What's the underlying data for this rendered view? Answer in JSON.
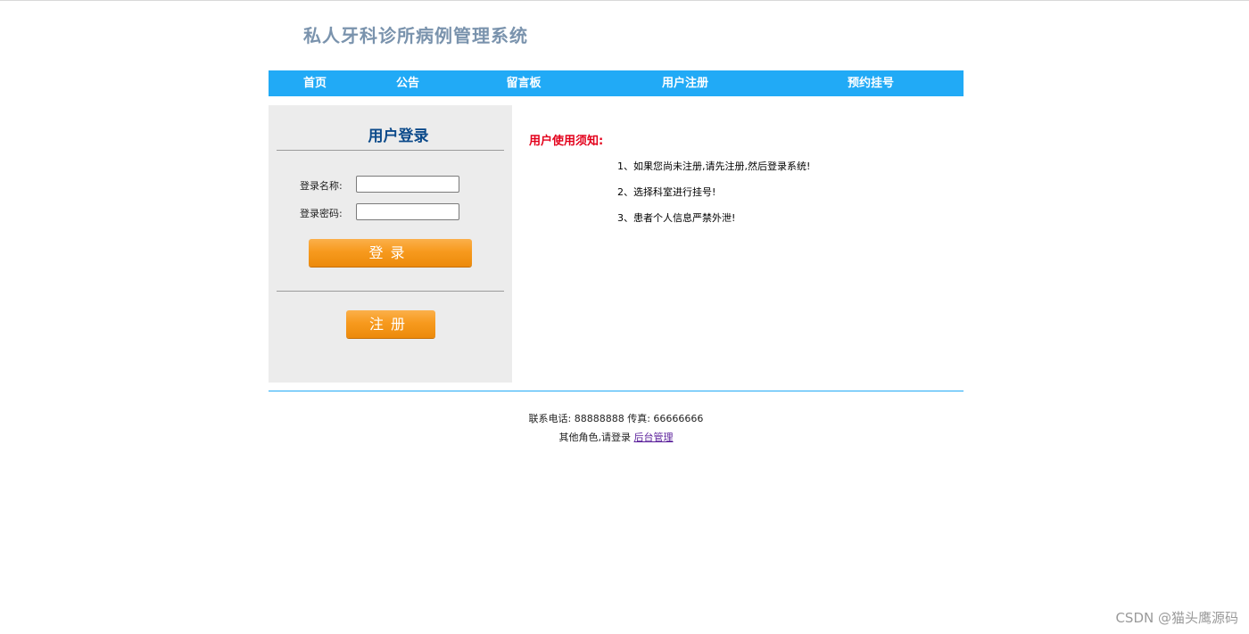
{
  "header": {
    "site_title": "私人牙科诊所病例管理系统"
  },
  "nav": {
    "items": [
      {
        "label": "首页"
      },
      {
        "label": "公告"
      },
      {
        "label": "留言板"
      },
      {
        "label": "用户注册"
      },
      {
        "label": "预约挂号"
      }
    ]
  },
  "login": {
    "title": "用户登录",
    "username_label": "登录名称:",
    "username_value": "",
    "password_label": "登录密码:",
    "password_value": "",
    "login_button": "登录",
    "register_button": "注册"
  },
  "notice": {
    "title": "用户使用须知:",
    "items": [
      "1、如果您尚未注册,请先注册,然后登录系统!",
      "2、选择科室进行挂号!",
      "3、患者个人信息严禁外泄!"
    ]
  },
  "footer": {
    "contact": "联系电话: 88888888 传真: 66666666",
    "other_roles_text": "其他角色,请登录",
    "admin_link": "后台管理"
  },
  "watermark": "CSDN @猫头鹰源码",
  "colors": {
    "nav_bg": "#21aaf6",
    "title_color": "#7a93ad",
    "login_title_color": "#0c4a8a",
    "notice_title_color": "#e3001b",
    "button_orange": "#f79a1e",
    "sidebar_bg": "#ececec"
  }
}
